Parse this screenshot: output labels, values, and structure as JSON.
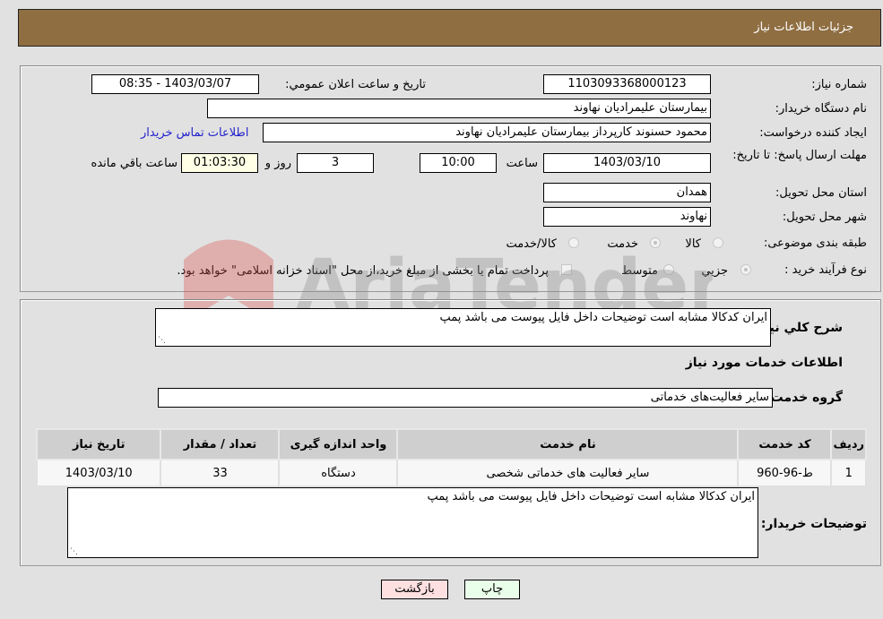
{
  "header": {
    "title": "جزئیات اطلاعات نیاز"
  },
  "form": {
    "need_number_label": "شماره نیاز:",
    "need_number": "1103093368000123",
    "announce_label": "تاریخ و ساعت اعلان عمومي:",
    "announce_value": "1403/03/07 - 08:35",
    "buyer_org_label": "نام دستگاه خريدار:",
    "buyer_org": "بیمارستان علیمرادیان نهاوند",
    "creator_label": "ایجاد کننده درخواست:",
    "creator": "محمود حسنوند کارپرداز بیمارستان علیمرادیان نهاوند",
    "contact_link": "اطلاعات تماس خريدار",
    "deadline_label": "مهلت ارسال پاسخ: تا تاریخ:",
    "deadline_date": "1403/03/10",
    "time_label": "ساعت",
    "deadline_time": "10:00",
    "days_value": "3",
    "days_label": "روز و",
    "remaining_value": "01:03:30",
    "remaining_label": "ساعت باقي مانده",
    "province_label": "استان محل تحویل:",
    "province": "همدان",
    "city_label": "شهر محل تحویل:",
    "city": "نهاوند",
    "category_label": "طبقه بندی موضوعی:",
    "category_options": [
      "کالا",
      "خدمت",
      "کالا/خدمت"
    ],
    "category_selected": "خدمت",
    "process_label": "نوع فرآیند خرید :",
    "process_options": [
      "جزيي",
      "متوسط"
    ],
    "process_selected": "جزيي",
    "treasury_note": "پرداخت تمام یا بخشی از مبلغ خرید،از محل \"اسناد خزانه اسلامی\" خواهد بود."
  },
  "details": {
    "general_desc_label": "شرح كلي نياز:",
    "general_desc": "ایران کدکالا مشابه است توضیحات داخل فایل پیوست می باشد پمپ",
    "services_heading": "اطلاعات خدمات مورد نياز",
    "service_group_label": "گروه خدمت:",
    "service_group": "سایر فعالیت‌های خدماتی",
    "table": {
      "headers": [
        "رديف",
        "کد خدمت",
        "نام خدمت",
        "واحد اندازه گيری",
        "تعداد / مقدار",
        "تاریخ نیاز"
      ],
      "rows": [
        [
          "1",
          "ط-96-960",
          "سایر فعالیت های خدماتی شخصی",
          "دستگاه",
          "33",
          "1403/03/10"
        ]
      ]
    },
    "buyer_notes_label": "توضيحات خريدار:",
    "buyer_notes": "ایران کدکالا مشابه است توضیحات داخل فایل پیوست می باشد پمپ"
  },
  "buttons": {
    "print": "چاپ",
    "back": "بازگشت"
  },
  "watermark": {
    "text": "AriaTender.neT"
  },
  "colors": {
    "header_bg": "#8f6e42",
    "print_bg": "#eaffea",
    "back_bg": "#ffe0e0",
    "link": "#2222cc"
  }
}
